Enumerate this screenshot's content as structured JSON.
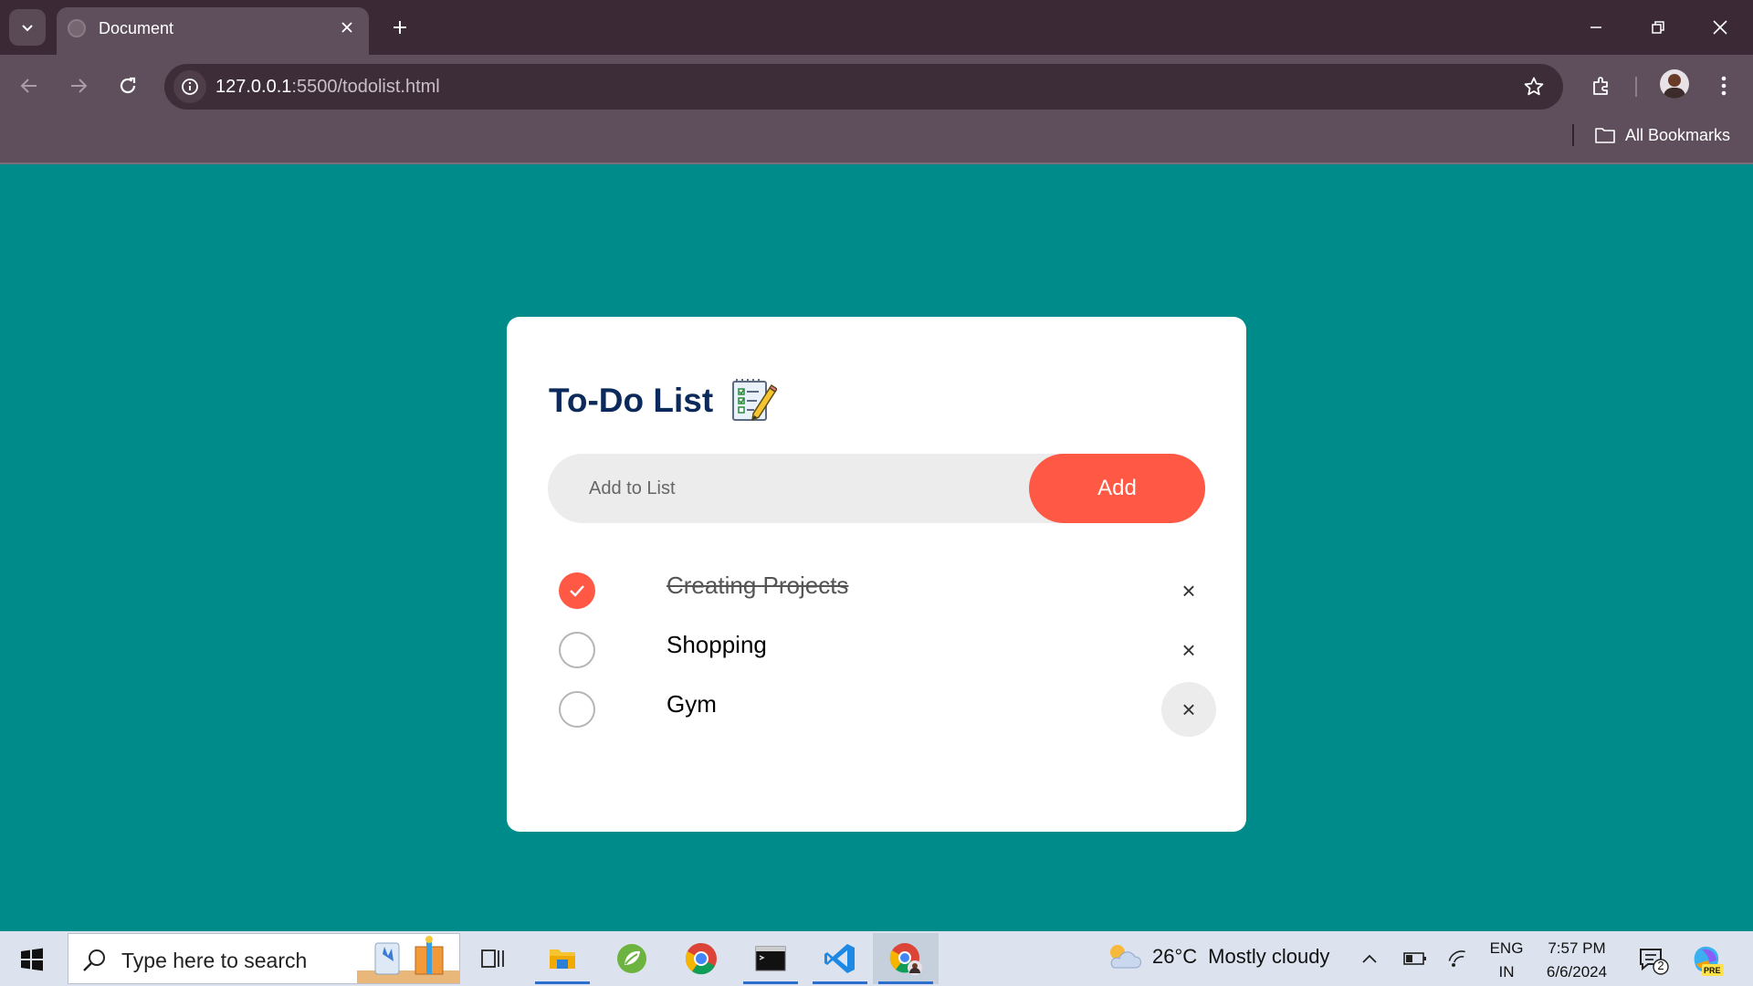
{
  "browser": {
    "tab_title": "Document",
    "url_host": "127.0.0.1",
    "url_path": ":5500/todolist.html",
    "bookmarks_label": "All Bookmarks"
  },
  "todo": {
    "title": "To-Do List",
    "title_icon": "notepad-pencil-icon",
    "input_placeholder": "Add to List",
    "add_label": "Add",
    "accent_color": "#ff5945",
    "title_color": "#0b2a5b",
    "background_color": "#008b8b",
    "tasks": [
      {
        "text": "Creating Projects",
        "done": true
      },
      {
        "text": "Shopping",
        "done": false
      },
      {
        "text": "Gym",
        "done": false
      }
    ],
    "delete_glyph": "×"
  },
  "taskbar": {
    "search_placeholder": "Type here to search",
    "apps": [
      "task-view-icon",
      "file-explorer-icon",
      "spring-tools-icon",
      "chrome-icon",
      "terminal-icon",
      "vscode-icon",
      "chrome-profile-icon"
    ],
    "weather_temp": "26°C",
    "weather_text": "Mostly cloudy",
    "lang_line1": "ENG",
    "lang_line2": "IN",
    "time": "7:57 PM",
    "date": "6/6/2024",
    "notification_count": "2",
    "copilot_badge": "PRE"
  }
}
